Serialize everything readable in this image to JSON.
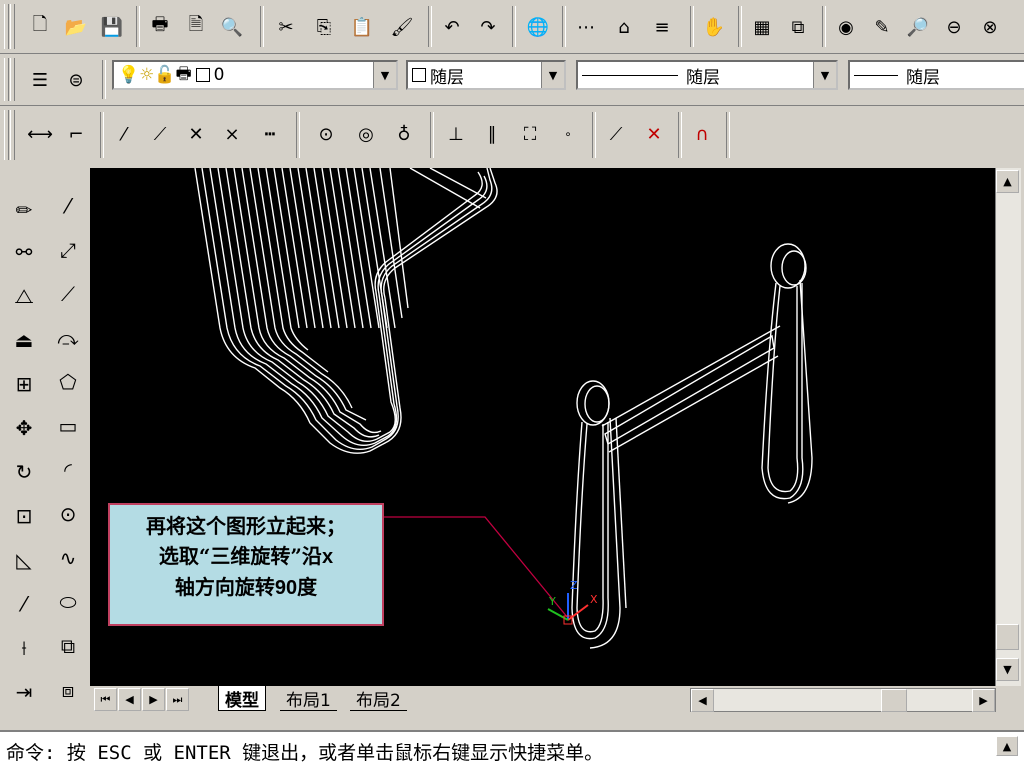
{
  "toolbar_standard": {
    "icons": [
      "new-file-icon",
      "open-folder-icon",
      "save-icon",
      "print-icon",
      "print-preview-icon",
      "spell-check-icon",
      "cut-icon",
      "copy-icon",
      "paste-icon",
      "match-properties-icon",
      "undo-icon",
      "redo-icon",
      "publish-web-icon",
      "hyperlink-icon",
      "tracking-icon",
      "snap-icon",
      "pan-realtime-icon",
      "zoom-realtime-icon",
      "zoom-window-icon",
      "zoom-previous-icon",
      "properties-icon",
      "design-center-icon"
    ]
  },
  "toolbar_layers": {
    "layer_value": "0",
    "color_value": "随层",
    "linetype_value": "随层",
    "lineweight_value": "随层"
  },
  "toolbar_dimension": {
    "icons": [
      "dim-linear-icon",
      "dim-aligned-icon",
      "dim-ordinate-icon",
      "dim-radius-icon",
      "dim-diameter-icon",
      "dim-angular-icon",
      "quick-dim-icon",
      "dim-baseline-icon",
      "dim-continue-icon",
      "leader-icon",
      "tolerance-icon",
      "center-mark-icon",
      "dim-edit-icon",
      "dim-text-edit-icon",
      "dim-update-icon",
      "dim-style-icon"
    ]
  },
  "modify_toolbar": [
    "erase-icon",
    "copy-object-icon",
    "mirror-icon",
    "offset-icon",
    "array-icon",
    "move-icon",
    "rotate-icon",
    "scale-icon",
    "stretch-icon",
    "lengthen-icon",
    "trim-icon",
    "extend-icon"
  ],
  "draw_toolbar": [
    "line-icon",
    "construction-line-icon",
    "polyline-icon",
    "polygon-icon",
    "rectangle-icon",
    "arc-icon",
    "circle-icon",
    "spline-icon",
    "ellipse-icon",
    "insert-block-icon",
    "make-block-icon"
  ],
  "note": {
    "line1": "再将这个图形立起来；",
    "line2a": "选取“三维旋转”沿",
    "line2b": "x",
    "line3a": "轴方向旋转",
    "line3b": "90",
    "line3c": "度"
  },
  "ucs_labels": {
    "x": "X",
    "y": "Y",
    "z": "Z"
  },
  "tabs": {
    "model": "模型",
    "layout1": "布局1",
    "layout2": "布局2"
  },
  "command": {
    "text": "命令: 按 ESC 或 ENTER 键退出，或者单击鼠标右键显示快捷菜单。"
  },
  "colors": {
    "canvas_bg": "#000000",
    "note_bg": "#b4dce4",
    "note_border": "#c04060",
    "wire": "#ffffff"
  }
}
